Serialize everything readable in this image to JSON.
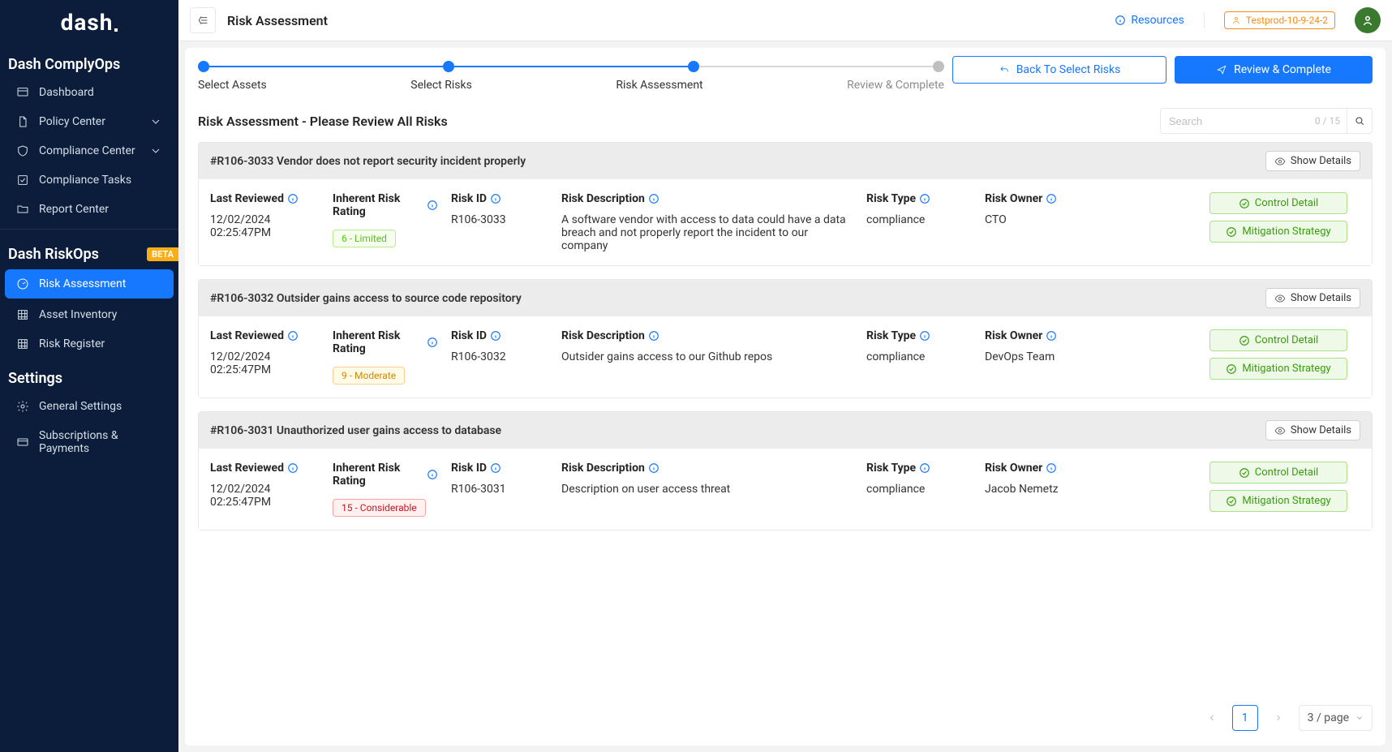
{
  "brand": "dash",
  "sections": {
    "complyops": {
      "title": "Dash ComplyOps",
      "items": [
        {
          "label": "Dashboard"
        },
        {
          "label": "Policy Center"
        },
        {
          "label": "Compliance Center"
        },
        {
          "label": "Compliance Tasks"
        },
        {
          "label": "Report Center"
        }
      ]
    },
    "riskops": {
      "title": "Dash RiskOps",
      "badge": "BETA",
      "items": [
        {
          "label": "Risk Assessment"
        },
        {
          "label": "Asset Inventory"
        },
        {
          "label": "Risk Register"
        }
      ]
    },
    "settings": {
      "title": "Settings",
      "items": [
        {
          "label": "General Settings"
        },
        {
          "label": "Subscriptions & Payments"
        }
      ]
    }
  },
  "topbar": {
    "page_title": "Risk Assessment",
    "resources": "Resources",
    "user_tag": "Testprod-10-9-24-2"
  },
  "steps": {
    "labels": [
      "Select Assets",
      "Select Risks",
      "Risk Assessment",
      "Review & Complete"
    ],
    "back_btn": "Back To Select Risks",
    "next_btn": "Review & Complete"
  },
  "subhead": {
    "title": "Risk Assessment - Please Review All Risks",
    "search_placeholder": "Search",
    "search_count": "0 / 15"
  },
  "columns": {
    "last_reviewed": "Last Reviewed",
    "inherent": "Inherent Risk Rating",
    "risk_id": "Risk ID",
    "risk_desc": "Risk Description",
    "risk_type": "Risk Type",
    "risk_owner": "Risk Owner"
  },
  "actions": {
    "show_details": "Show Details",
    "control_detail": "Control Detail",
    "mitigation": "Mitigation Strategy"
  },
  "risks": [
    {
      "title": "#R106-3033 Vendor does not report security incident properly",
      "last_reviewed": "12/02/2024 02:25:47PM",
      "rating": "6 - Limited",
      "rating_class": "limited",
      "risk_id": "R106-3033",
      "description": "A software vendor with access to data could have a data breach and not properly report the incident to our company",
      "type": "compliance",
      "owner": "CTO"
    },
    {
      "title": "#R106-3032 Outsider gains access to source code repository",
      "last_reviewed": "12/02/2024 02:25:47PM",
      "rating": "9 - Moderate",
      "rating_class": "moderate",
      "risk_id": "R106-3032",
      "description": "Outsider gains access to our Github repos",
      "type": "compliance",
      "owner": "DevOps Team"
    },
    {
      "title": "#R106-3031 Unauthorized user gains access to database",
      "last_reviewed": "12/02/2024 02:25:47PM",
      "rating": "15 - Considerable",
      "rating_class": "considerable",
      "risk_id": "R106-3031",
      "description": "Description on user access threat",
      "type": "compliance",
      "owner": "Jacob Nemetz"
    }
  ],
  "pager": {
    "page": "1",
    "size_label": "3 / page"
  }
}
